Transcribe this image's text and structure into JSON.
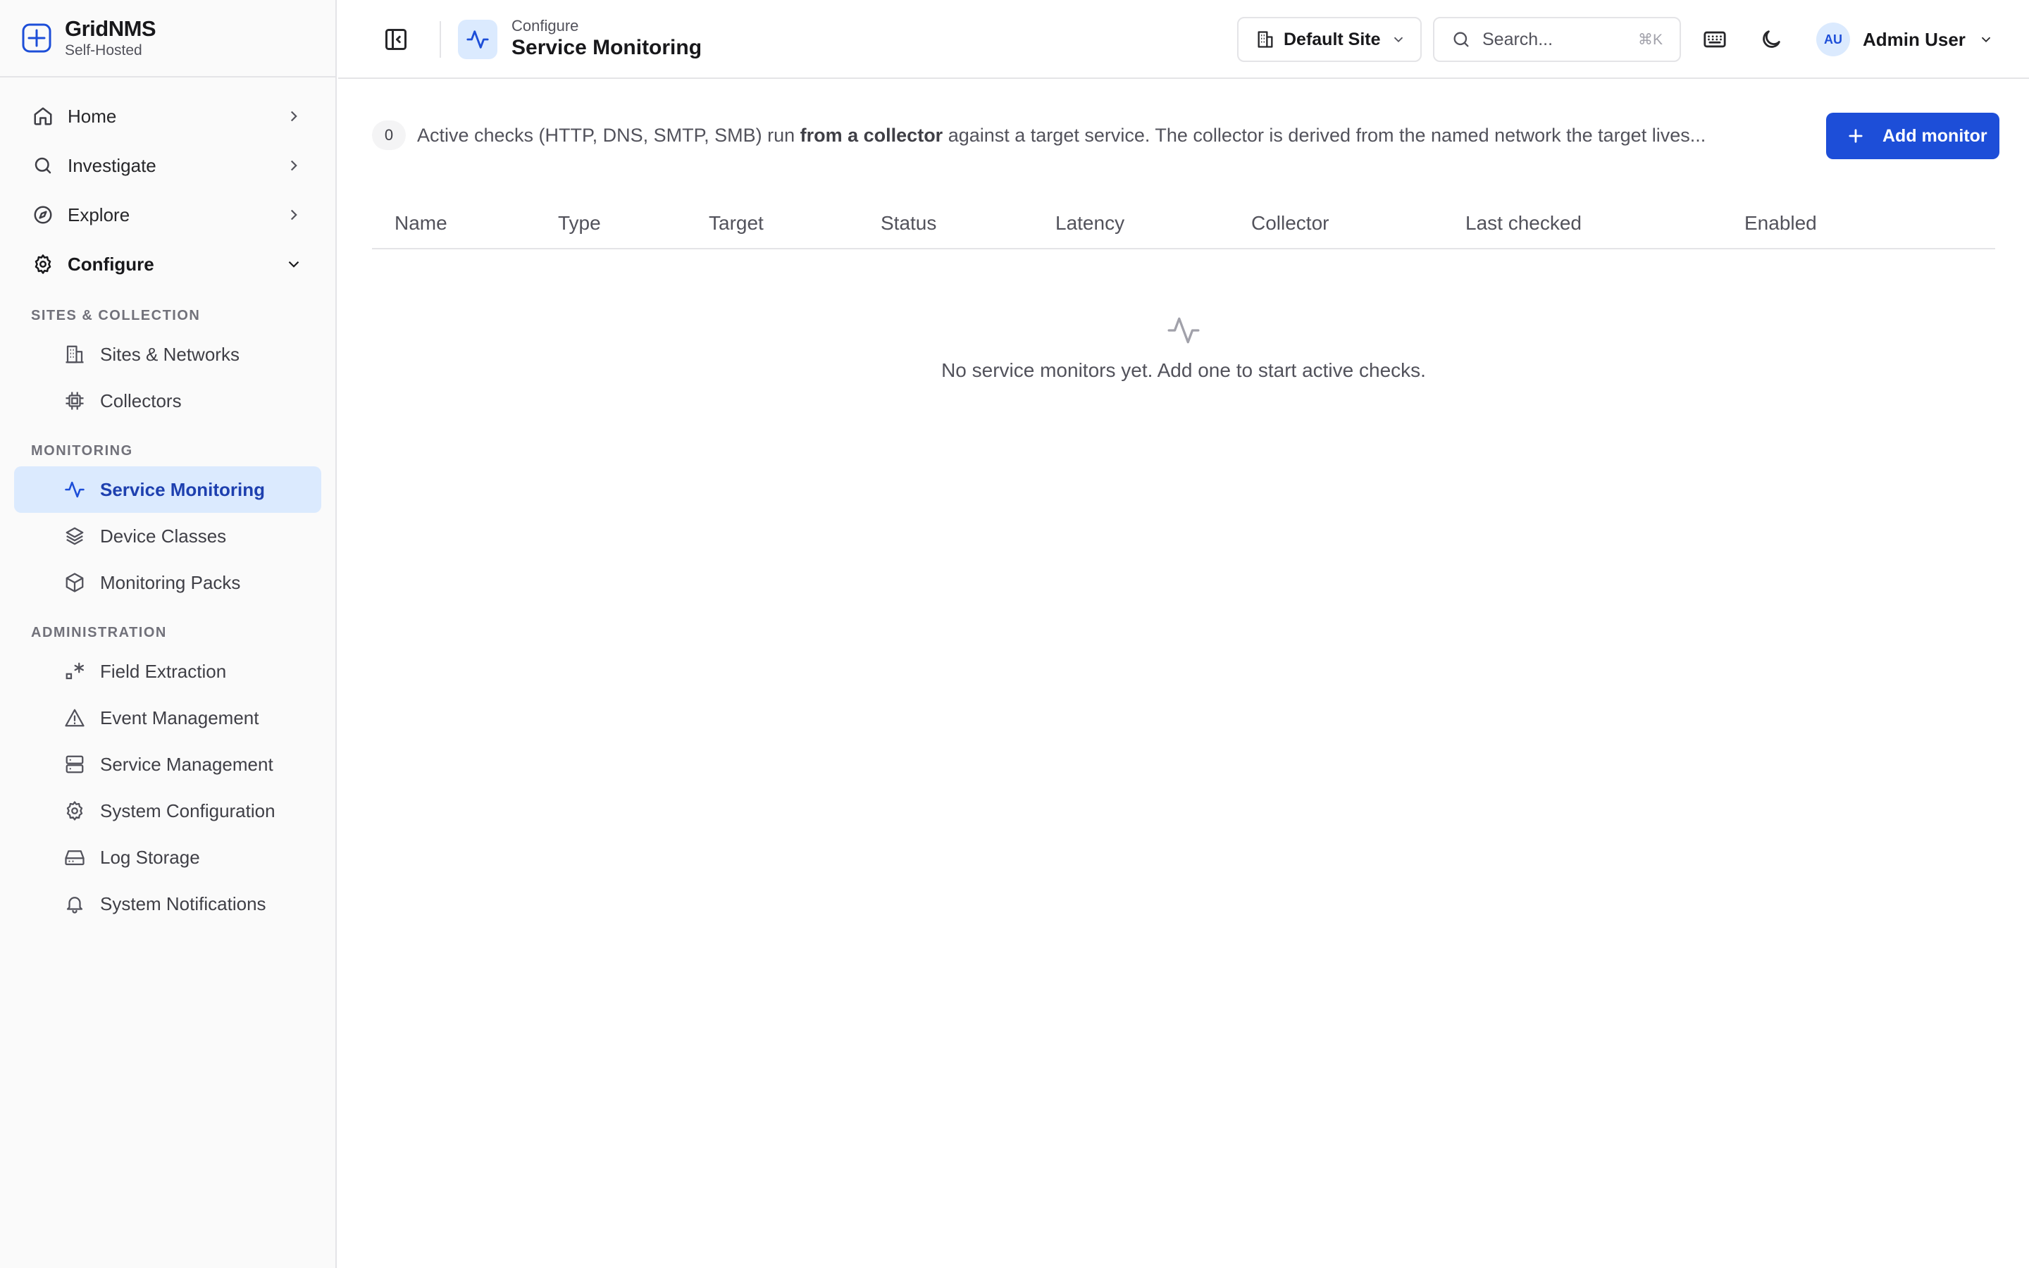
{
  "brand": {
    "name": "GridNMS",
    "subtitle": "Self-Hosted"
  },
  "nav": {
    "items": [
      {
        "label": "Home",
        "icon": "home-icon"
      },
      {
        "label": "Investigate",
        "icon": "search-icon"
      },
      {
        "label": "Explore",
        "icon": "compass-icon"
      },
      {
        "label": "Configure",
        "icon": "gear-icon",
        "expanded": true
      }
    ],
    "sections": [
      {
        "label": "SITES & COLLECTION",
        "items": [
          {
            "label": "Sites & Networks",
            "icon": "building-icon"
          },
          {
            "label": "Collectors",
            "icon": "chip-icon"
          }
        ]
      },
      {
        "label": "MONITORING",
        "items": [
          {
            "label": "Service Monitoring",
            "icon": "activity-icon",
            "active": true
          },
          {
            "label": "Device Classes",
            "icon": "layers-icon"
          },
          {
            "label": "Monitoring Packs",
            "icon": "package-icon"
          }
        ]
      },
      {
        "label": "ADMINISTRATION",
        "items": [
          {
            "label": "Field Extraction",
            "icon": "extract-icon"
          },
          {
            "label": "Event Management",
            "icon": "warning-icon"
          },
          {
            "label": "Service Management",
            "icon": "server-icon"
          },
          {
            "label": "System Configuration",
            "icon": "gear-icon"
          },
          {
            "label": "Log Storage",
            "icon": "hard-drive-icon"
          },
          {
            "label": "System Notifications",
            "icon": "bell-icon"
          }
        ]
      }
    ]
  },
  "header": {
    "breadcrumb": "Configure",
    "title": "Service Monitoring",
    "site": "Default Site",
    "search_placeholder": "Search...",
    "search_shortcut": "⌘K",
    "user_initials": "AU",
    "user_name": "Admin User"
  },
  "main": {
    "count": "0",
    "info_prefix": "Active checks (HTTP, DNS, SMTP, SMB) run ",
    "info_bold": "from a collector",
    "info_suffix": " against a target service. The collector is derived from the named network the target lives...",
    "add_button": "Add monitor",
    "columns": [
      "Name",
      "Type",
      "Target",
      "Status",
      "Latency",
      "Collector",
      "Last checked",
      "Enabled"
    ],
    "empty_message": "No service monitors yet. Add one to start active checks."
  },
  "colors": {
    "accent": "#1d4ed8",
    "active_bg": "#dbeafe",
    "active_text": "#1e40af",
    "border": "#e4e4e7"
  }
}
